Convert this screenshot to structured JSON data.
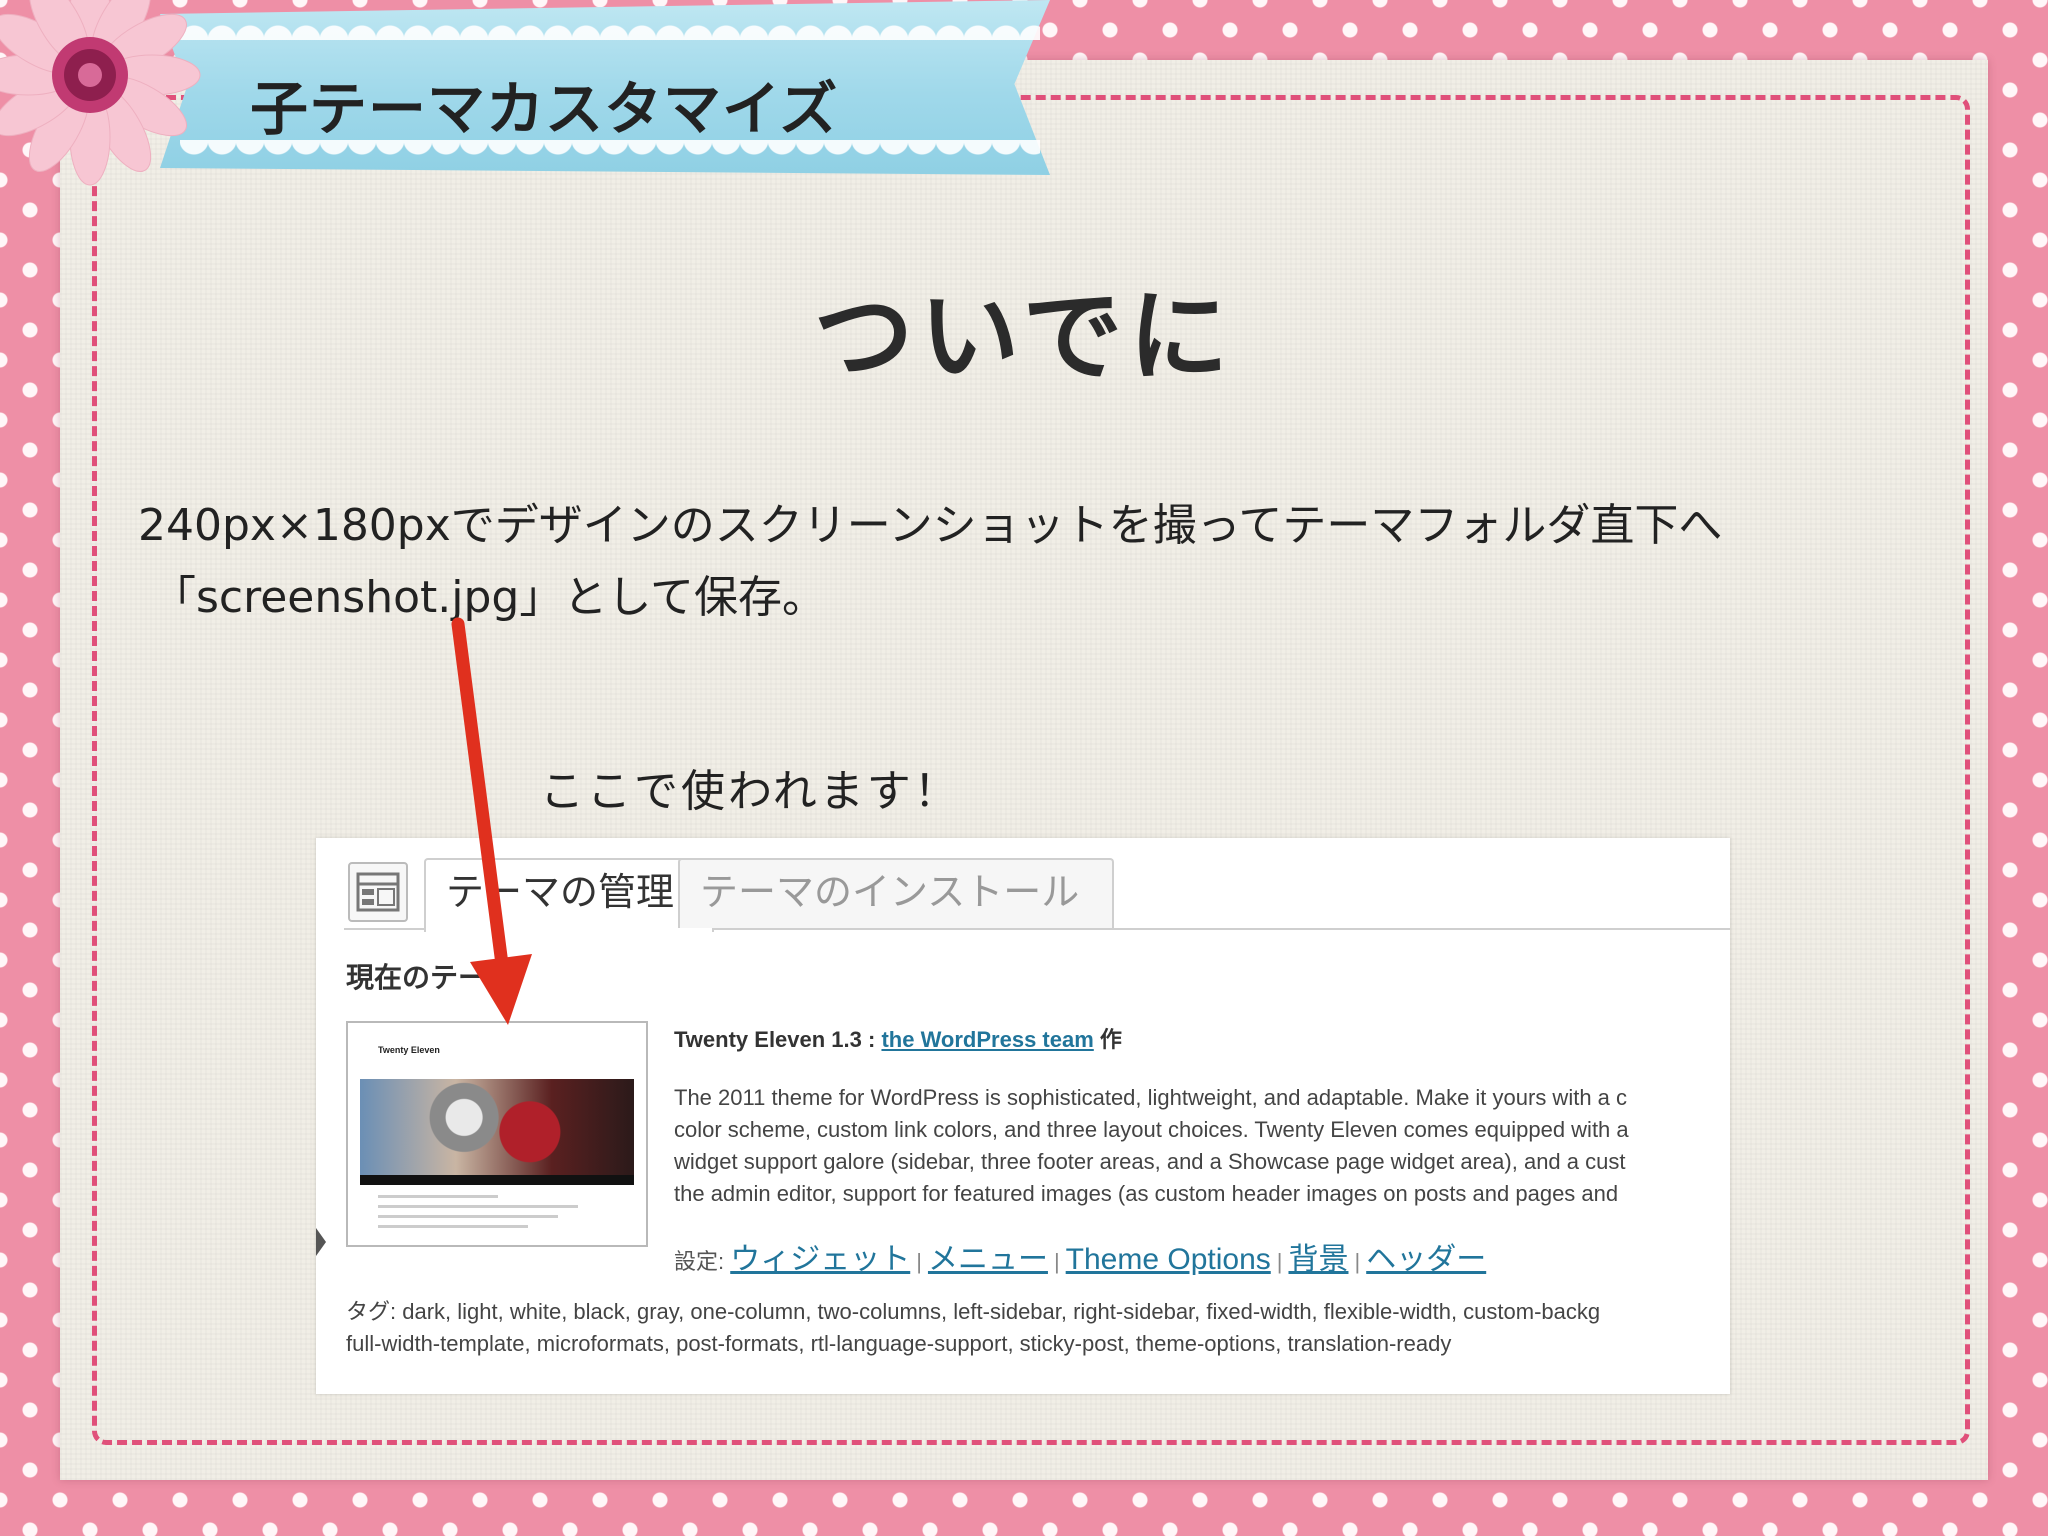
{
  "slide_title": "子テーマカスタマイズ",
  "heading": "ついでに",
  "paragraph": {
    "line1": "240px×180pxでデザインのスクリーンショットを撮ってテーマフォルダ直下へ",
    "line2": "「screenshot.jpg」として保存。"
  },
  "note": "ここで使われます！",
  "wp": {
    "tabs": [
      "テーマの管理",
      "テーマのインストール"
    ],
    "current_label": "現在のテー",
    "thumb_title": "Twenty Eleven",
    "theme_title": "Twenty Eleven 1.3 : ",
    "theme_author_link": "the WordPress team",
    "theme_author_suffix": " 作",
    "description": [
      "The 2011 theme for WordPress is sophisticated, lightweight, and adaptable. Make it yours with a c",
      "color scheme, custom link colors, and three layout choices. Twenty Eleven comes equipped with a",
      "widget support galore (sidebar, three footer areas, and a Showcase page widget area), and a cust",
      "the admin editor, support for featured images (as custom header images on posts and pages and"
    ],
    "settings_label": "設定: ",
    "settings_links": [
      "ウィジェット",
      "メニュー",
      "Theme Options",
      "背景",
      "ヘッダー"
    ],
    "tags": [
      "タグ: dark, light, white, black, gray, one-column, two-columns, left-sidebar, right-sidebar, fixed-width, flexible-width, custom-backg",
      "full-width-template, microformats, post-formats, rtl-language-support, sticky-post, theme-options, translation-ready"
    ]
  },
  "colors": {
    "background_pink": "#ee8fa6",
    "stitch": "#e0507a",
    "arrow": "#e0301e",
    "link": "#21759b"
  },
  "icons": [
    "flower-decoration-icon",
    "theme-page-icon",
    "red-arrow-icon"
  ]
}
